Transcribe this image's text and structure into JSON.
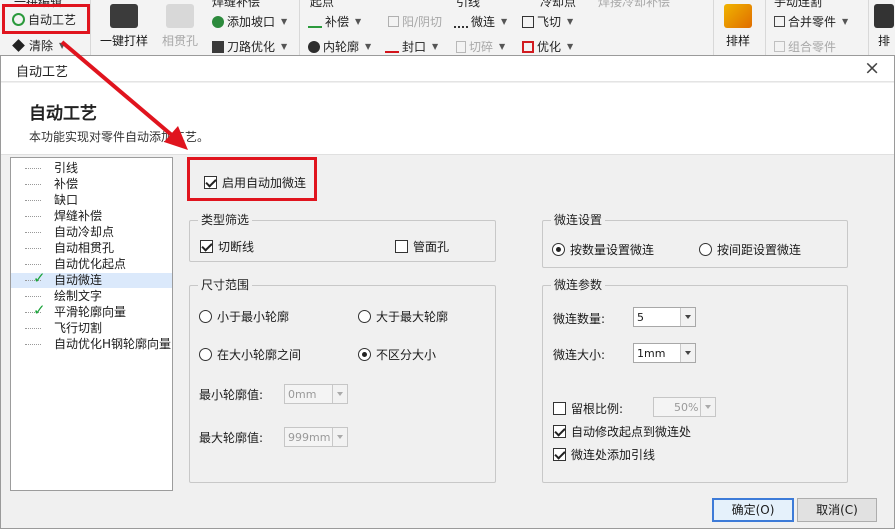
{
  "ribbon": {
    "top_left_partial": "一拼编辑",
    "auto_process_label": "自动工艺",
    "clear_label": "清除",
    "one_key_label": "一键打样",
    "phase_hole_label": "相贯孔",
    "weld_partial": "焊缝补偿",
    "add_slope_label": "添加坡口",
    "tool_opt_label": "刀路优化",
    "lead_partial": "起点",
    "comp_label": "补偿",
    "inner_contour_label": "内轮廓",
    "yinyang_label": "阳/阴切",
    "seal_label": "封口",
    "lead2_partial": "引线",
    "microjoint_label": "微连",
    "cut_label": "切碎",
    "fly_cut_label": "飞切",
    "optimize_label": "优化",
    "sort_partial": "冷却点",
    "weld2_partial": "焊接冷却补偿",
    "arrange_label": "排样",
    "manual_partial": "手动连割",
    "merge_label": "合并零件",
    "group_label": "组合零件",
    "far_right_label": "排"
  },
  "dialog": {
    "title": "自动工艺",
    "close": "×",
    "heading": "自动工艺",
    "description": "本功能实现对零件自动添加工艺。"
  },
  "tree": {
    "items": [
      {
        "label": "引线",
        "checked": false,
        "selected": false
      },
      {
        "label": "补偿",
        "checked": false,
        "selected": false
      },
      {
        "label": "缺口",
        "checked": false,
        "selected": false
      },
      {
        "label": "焊缝补偿",
        "checked": false,
        "selected": false
      },
      {
        "label": "自动冷却点",
        "checked": false,
        "selected": false
      },
      {
        "label": "自动相贯孔",
        "checked": false,
        "selected": false
      },
      {
        "label": "自动优化起点",
        "checked": false,
        "selected": false
      },
      {
        "label": "自动微连",
        "checked": true,
        "selected": true
      },
      {
        "label": "绘制文字",
        "checked": false,
        "selected": false
      },
      {
        "label": "平滑轮廓向量",
        "checked": true,
        "selected": false
      },
      {
        "label": "飞行切割",
        "checked": false,
        "selected": false
      },
      {
        "label": "自动优化H钢轮廓向量",
        "checked": false,
        "selected": false
      }
    ]
  },
  "enable_label": "启用自动加微连",
  "type_filter": {
    "title": "类型筛选",
    "cutoff_label": "切断线",
    "pipe_hole_label": "管面孔"
  },
  "size_range": {
    "title": "尺寸范围",
    "less_min_label": "小于最小轮廓",
    "greater_max_label": "大于最大轮廓",
    "between_label": "在大小轮廓之间",
    "any_label": "不区分大小",
    "min_value_label": "最小轮廓值:",
    "min_value": "0mm",
    "max_value_label": "最大轮廓值:",
    "max_value": "999mm"
  },
  "micro_settings": {
    "title": "微连设置",
    "by_count_label": "按数量设置微连",
    "by_spacing_label": "按间距设置微连"
  },
  "micro_params": {
    "title": "微连参数",
    "count_label": "微连数量:",
    "count_value": "5",
    "size_label": "微连大小:",
    "size_value": "1mm",
    "keep_ratio_label": "留根比例:",
    "keep_ratio_value": "50%",
    "auto_modify_label": "自动修改起点到微连处",
    "add_lead_label": "微连处添加引线"
  },
  "buttons": {
    "ok_label": "确定(O)",
    "cancel_label": "取消(C)"
  }
}
